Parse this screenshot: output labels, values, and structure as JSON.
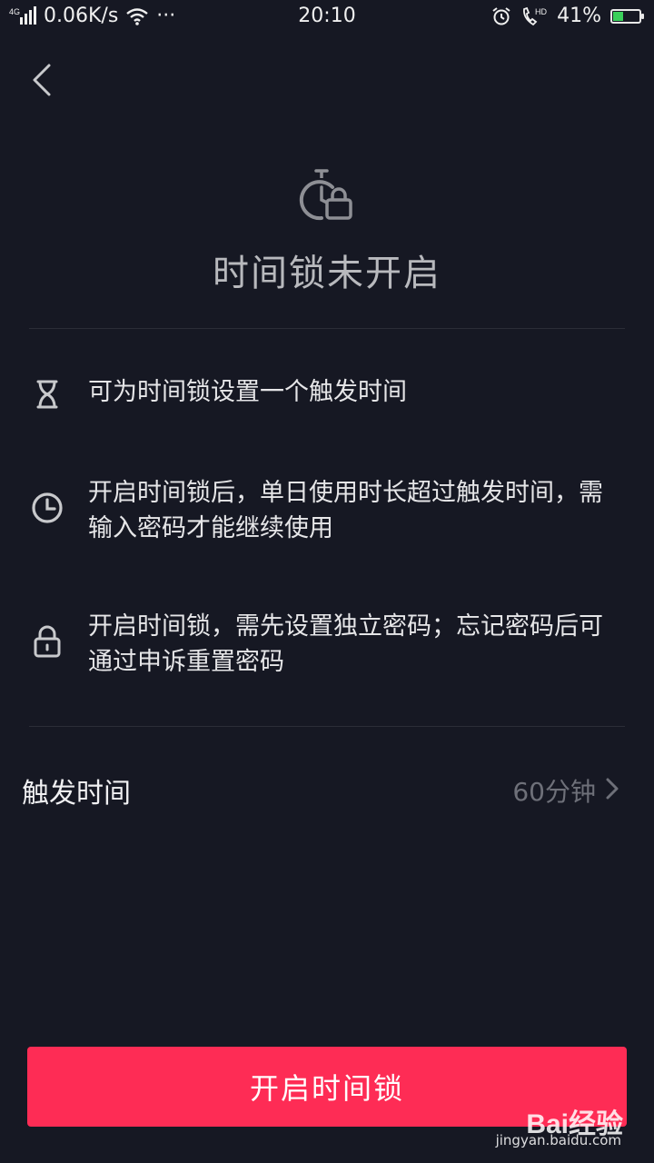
{
  "status_bar": {
    "network_type": "4G",
    "speed": "0.06K/s",
    "more": "···",
    "time": "20:10",
    "call_hd": "HD",
    "battery_percent": "41%",
    "battery_level": 0.41
  },
  "header": {
    "back_icon": "chevron-left-icon"
  },
  "hero": {
    "icon": "timer-lock-icon",
    "title": "时间锁未开启"
  },
  "features": [
    {
      "icon": "hourglass-icon",
      "text": "可为时间锁设置一个触发时间"
    },
    {
      "icon": "clock-icon",
      "text": "开启时间锁后，单日使用时长超过触发时间，需输入密码才能继续使用"
    },
    {
      "icon": "lock-icon",
      "text": "开启时间锁，需先设置独立密码；忘记密码后可通过申诉重置密码"
    }
  ],
  "setting": {
    "label": "触发时间",
    "value": "60分钟"
  },
  "button": {
    "label": "开启时间锁"
  },
  "watermark": {
    "logo": "Bai经验",
    "url": "jingyan.baidu.com"
  },
  "colors": {
    "background": "#161823",
    "accent": "#fe2c55",
    "divider": "#2b2d37",
    "muted": "#6e7079"
  }
}
